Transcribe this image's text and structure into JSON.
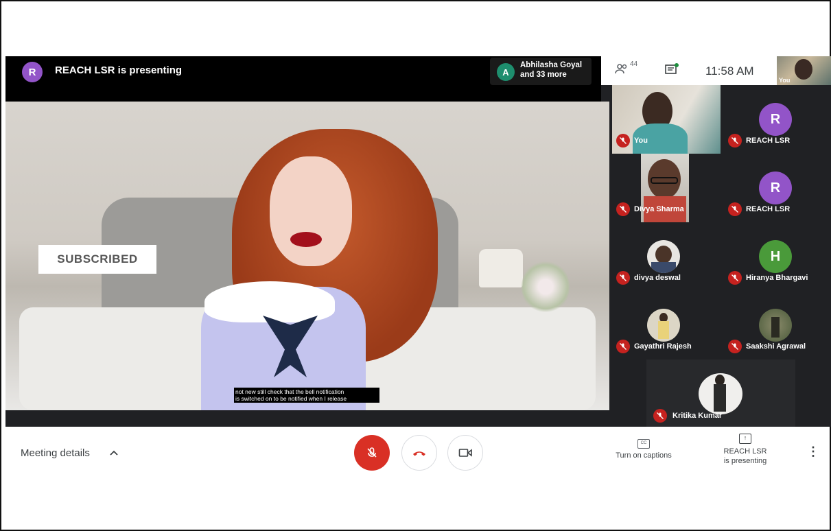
{
  "topbar": {
    "presenter_initial": "R",
    "presenting_text": "REACH LSR is presenting",
    "viewers_initial": "A",
    "viewers_line1": "Abhilasha Goyal",
    "viewers_line2": "and 33 more"
  },
  "header": {
    "people_count": "44",
    "people_icon": "people-icon",
    "chat_icon": "chat-icon",
    "time": "11:58 AM",
    "self_label": "You"
  },
  "presentation": {
    "overlay_badge": "SUBSCRIBED",
    "caption_line1": "not new still check that the bell notification",
    "caption_line2": "is switched on to be notified when I release"
  },
  "participants": [
    {
      "name": "You",
      "type": "video"
    },
    {
      "name": "REACH LSR",
      "type": "initial",
      "initial": "R",
      "color": "#9254c8"
    },
    {
      "name": "Divya Sharma",
      "type": "video"
    },
    {
      "name": "REACH LSR",
      "type": "initial",
      "initial": "R",
      "color": "#9254c8"
    },
    {
      "name": "divya deswal",
      "type": "photo"
    },
    {
      "name": "Hiranya Bhargavi",
      "type": "initial",
      "initial": "H",
      "color": "#4a9a3a"
    },
    {
      "name": "Gayathri Rajesh",
      "type": "photo"
    },
    {
      "name": "Saakshi Agrawal",
      "type": "photo"
    },
    {
      "name": "Kritika Kumar",
      "type": "photo"
    }
  ],
  "bottombar": {
    "meeting_details": "Meeting details",
    "captions_label": "Turn on captions",
    "captions_icon_text": "CC",
    "present_line1": "REACH LSR",
    "present_line2": "is presenting"
  },
  "colors": {
    "mic_off_red": "#d93025",
    "presenter_purple": "#9254c8",
    "dark_bg": "#202124"
  }
}
